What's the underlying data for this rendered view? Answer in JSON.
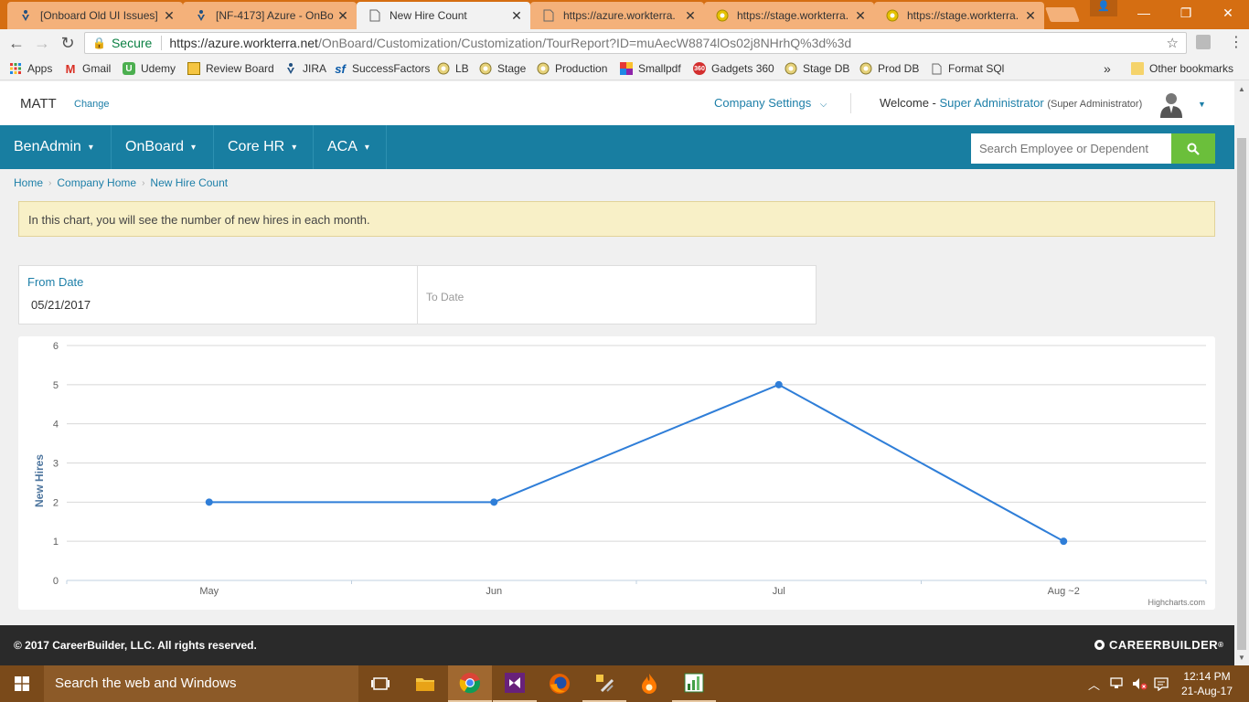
{
  "browser": {
    "tabs": [
      {
        "title": "[Onboard Old UI Issues]",
        "icon": "jira-icon",
        "active": false
      },
      {
        "title": "[NF-4173] Azure - OnBo",
        "icon": "jira-icon",
        "active": false
      },
      {
        "title": "New Hire Count",
        "icon": "page-icon",
        "active": true
      },
      {
        "title": "https://azure.workterra.",
        "icon": "page-icon",
        "active": false
      },
      {
        "title": "https://stage.workterra.",
        "icon": "stage-icon",
        "active": false
      },
      {
        "title": "https://stage.workterra.",
        "icon": "stage-icon",
        "active": false
      }
    ],
    "secure_label": "Secure",
    "url_host": "https://azure.workterra.net",
    "url_path": "/OnBoard/Customization/Customization/TourReport?ID=muAecW8874lOs02j8NHrhQ%3d%3d",
    "bookmarks": [
      {
        "label": "Apps",
        "icon": "apps-grid-icon"
      },
      {
        "label": "Gmail",
        "icon": "gmail-icon"
      },
      {
        "label": "Udemy",
        "icon": "udemy-icon"
      },
      {
        "label": "Review Board",
        "icon": "review-board-icon"
      },
      {
        "label": "JIRA",
        "icon": "jira-icon"
      },
      {
        "label": "SuccessFactors",
        "icon": "successfactors-icon"
      },
      {
        "label": "LB",
        "icon": "globe-icon"
      },
      {
        "label": "Stage",
        "icon": "globe-icon"
      },
      {
        "label": "Production",
        "icon": "globe-icon"
      },
      {
        "label": "Smallpdf",
        "icon": "smallpdf-icon"
      },
      {
        "label": "Gadgets 360",
        "icon": "gadgets-icon"
      },
      {
        "label": "Stage DB",
        "icon": "globe-icon"
      },
      {
        "label": "Prod DB",
        "icon": "globe-icon"
      },
      {
        "label": "Format SQl",
        "icon": "page-icon"
      }
    ],
    "more_bookmarks": "»",
    "other_bookmarks": "Other bookmarks"
  },
  "header": {
    "company": "MATT",
    "change": "Change",
    "settings": "Company Settings",
    "welcome": "Welcome -",
    "user_name": "Super Administrator",
    "user_role": "(Super Administrator)"
  },
  "nav": {
    "items": [
      "BenAdmin",
      "OnBoard",
      "Core HR",
      "ACA"
    ],
    "search_placeholder": "Search Employee or Dependent"
  },
  "breadcrumb": [
    "Home",
    "Company Home",
    "New Hire Count"
  ],
  "info": "In this chart, you will see the number of new hires in each month.",
  "dates": {
    "from_label": "From Date",
    "from_value": "05/21/2017",
    "to_placeholder": "To Date"
  },
  "chart_data": {
    "type": "line",
    "categories": [
      "May",
      "Jun",
      "Jul",
      "Aug ~2"
    ],
    "values": [
      2,
      2,
      5,
      1
    ],
    "ylabel": "New Hires",
    "ylim": [
      0,
      6
    ],
    "yticks": [
      0,
      1,
      2,
      3,
      4,
      5,
      6
    ],
    "grid": true,
    "color": "#2f7ed8",
    "credit": "Highcharts.com"
  },
  "footer": {
    "copyright": "© 2017 CareerBuilder, LLC. All rights reserved.",
    "brand": "CAREERBUILDER",
    "brand_suffix": "®"
  },
  "taskbar": {
    "search": "Search the web and Windows",
    "time": "12:14 PM",
    "date": "21-Aug-17"
  }
}
